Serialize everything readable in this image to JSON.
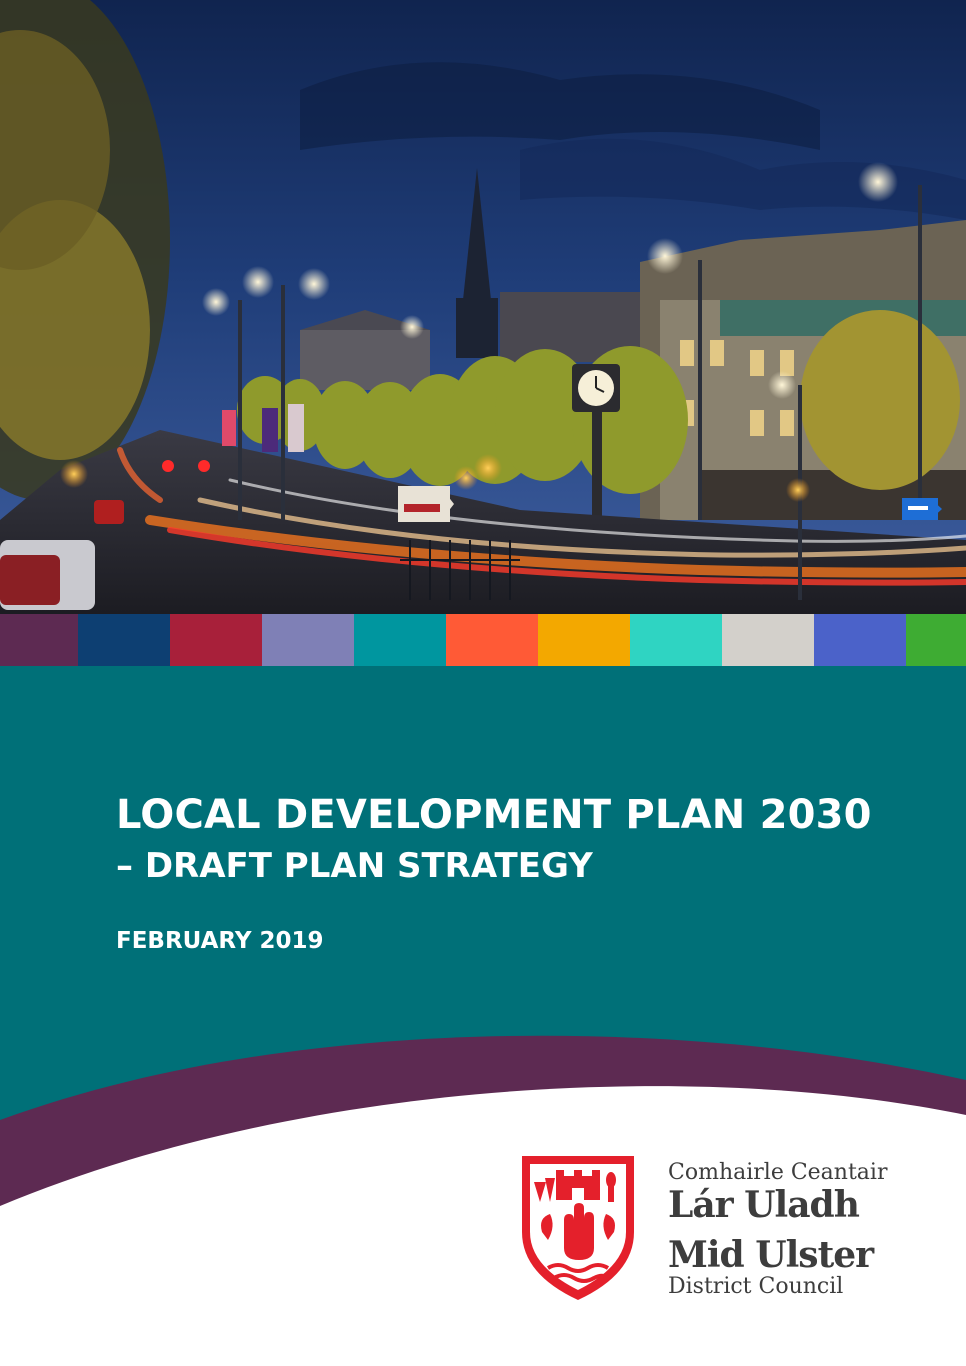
{
  "cover": {
    "title": "LOCAL DEVELOPMENT PLAN 2030",
    "subtitle": "– DRAFT PLAN STRATEGY",
    "date": "FEBRUARY 2019"
  },
  "photo": {
    "clock_face": "clock-icon",
    "road_sign_icon": "direction-sign-icon"
  },
  "colors": {
    "band": "#007078",
    "wave": "#5d2a52",
    "crest_red": "#e4202b",
    "stripes": [
      "#5d2a52",
      "#0d3f72",
      "#a8203a",
      "#7f80b6",
      "#00969f",
      "#ff5a36",
      "#f3a800",
      "#2fd4c2",
      "#d3d0cb",
      "#4b62c9",
      "#3eac33"
    ]
  },
  "logo": {
    "irish_line1": "Comhairle Ceantair",
    "irish_line2": "Lár Uladh",
    "english_line1": "Mid Ulster",
    "english_line2": "District Council",
    "crest": "council-crest-icon"
  }
}
